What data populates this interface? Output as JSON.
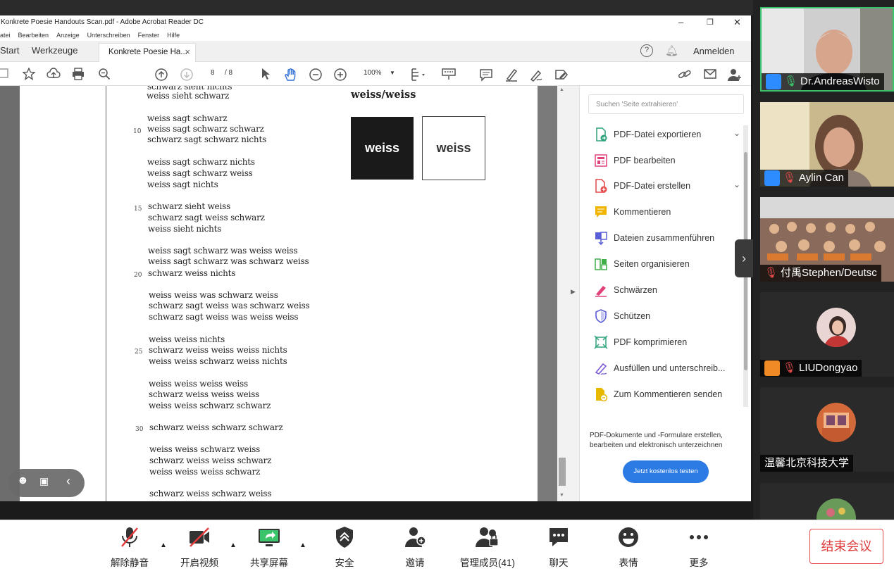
{
  "acrobat": {
    "window_title": "Konkrete Poesie Handouts Scan.pdf - Adobe Acrobat Reader DC",
    "menu": [
      "atei",
      "Bearbeiten",
      "Anzeige",
      "Unterschreiben",
      "Fenster",
      "Hilfe"
    ],
    "tabs": {
      "start": "Start",
      "tools": "Werkzeuge",
      "document": "Konkrete Poesie Ha..."
    },
    "signin": "Anmelden",
    "page_current": "8",
    "page_total": "/ 8",
    "zoom": "100%"
  },
  "document": {
    "heading": "weiss/weiss",
    "black_box_text": "weiss",
    "white_box_text": "weiss",
    "line_numbers": [
      "10",
      "15",
      "20",
      "25",
      "30"
    ],
    "lines": [
      "schwarz sieht nichts",
      "weiss sieht schwarz",
      "weiss sagt schwarz",
      "weiss sagt schwarz schwarz",
      "schwarz sagt schwarz nichts",
      "weiss sagt schwarz nichts",
      "weiss sagt schwarz weiss",
      "weiss sagt nichts",
      "schwarz sieht weiss",
      "schwarz sagt weiss schwarz",
      "weiss sieht nichts",
      "weiss sagt schwarz was weiss weiss",
      "weiss sagt schwarz was schwarz weiss",
      "schwarz weiss nichts",
      "weiss weiss was schwarz weiss",
      "schwarz sagt weiss was schwarz weiss",
      "schwarz sagt weiss was weiss weiss",
      "weiss weiss nichts",
      "schwarz weiss weiss weiss nichts",
      "weiss weiss schwarz weiss nichts",
      "weiss weiss weiss weiss",
      "schwarz weiss weiss weiss",
      "weiss weiss schwarz schwarz",
      "schwarz weiss schwarz schwarz",
      "weiss weiss schwarz weiss",
      "schwarz weiss weiss schwarz",
      "weiss weiss weiss schwarz",
      "schwarz weiss schwarz weiss"
    ]
  },
  "tools_pane": {
    "search_placeholder": "Suchen 'Seite extrahieren'",
    "items": [
      {
        "label": "PDF-Datei exportieren",
        "icon": "export-pdf-icon",
        "color": "#2fa37a"
      },
      {
        "label": "PDF bearbeiten",
        "icon": "edit-pdf-icon",
        "color": "#e0417b"
      },
      {
        "label": "PDF-Datei erstellen",
        "icon": "create-pdf-icon",
        "color": "#e64747"
      },
      {
        "label": "Kommentieren",
        "icon": "comment-icon",
        "color": "#f0b400"
      },
      {
        "label": "Dateien zusammenführen",
        "icon": "combine-icon",
        "color": "#5a5fd6"
      },
      {
        "label": "Seiten organisieren",
        "icon": "organize-icon",
        "color": "#3fae49"
      },
      {
        "label": "Schwärzen",
        "icon": "redact-icon",
        "color": "#e0417b"
      },
      {
        "label": "Schützen",
        "icon": "protect-icon",
        "color": "#5a5fd6"
      },
      {
        "label": "PDF komprimieren",
        "icon": "compress-icon",
        "color": "#2fa37a"
      },
      {
        "label": "Ausfüllen und unterschreib...",
        "icon": "fill-sign-icon",
        "color": "#7b5bd6"
      },
      {
        "label": "Zum Kommentieren senden",
        "icon": "send-comment-icon",
        "color": "#e6b800"
      }
    ],
    "promo_text": "PDF-Dokumente und -Formulare erstellen, bearbeiten und elektronisch unterzeichnen",
    "promo_button": "Jetzt kostenlos testen"
  },
  "participants": [
    {
      "name": "Dr.AndreasWisto",
      "type": "video"
    },
    {
      "name": "Aylin Can",
      "type": "video"
    },
    {
      "name": "付禹Stephen/Deutsc",
      "type": "video"
    },
    {
      "name": "LIUDongyao",
      "type": "avatar"
    },
    {
      "name": "温馨北京科技大学",
      "type": "avatar"
    }
  ],
  "meeting_bar": {
    "unmute": "解除静音",
    "start_video": "开启视频",
    "share_screen": "共享屏幕",
    "security": "安全",
    "invite": "邀请",
    "participants": "管理成员(41)",
    "chat": "聊天",
    "reactions": "表情",
    "more": "更多",
    "end": "结束会议"
  }
}
